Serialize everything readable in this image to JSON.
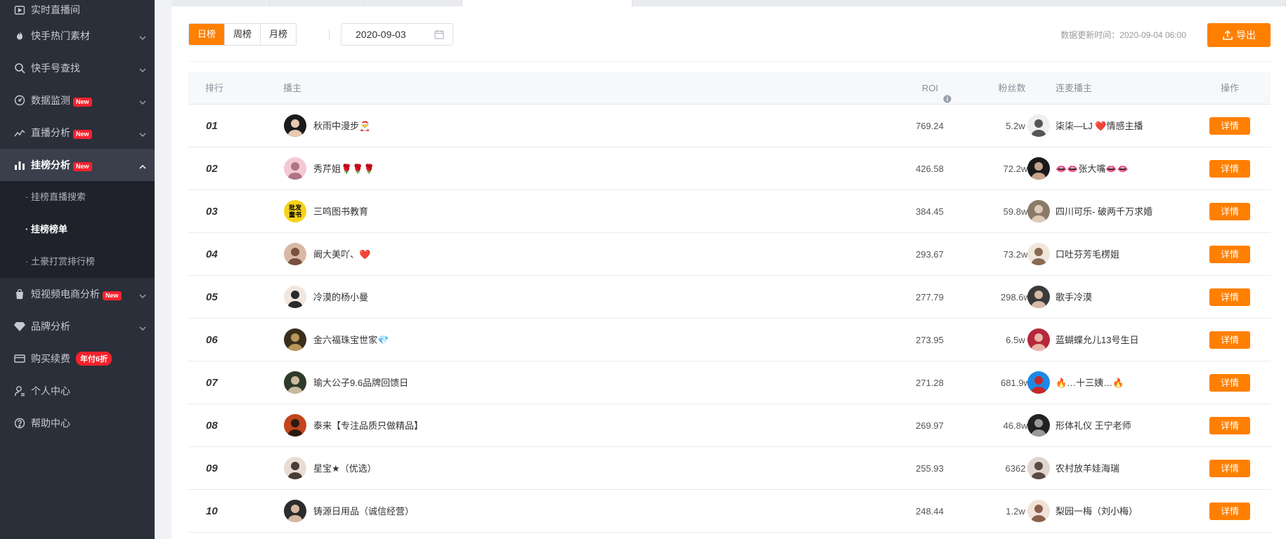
{
  "sidebar": {
    "items": [
      {
        "label": "实时直播间",
        "icon": "live-room-icon"
      },
      {
        "label": "快手热门素材",
        "icon": "fire-icon"
      },
      {
        "label": "快手号查找",
        "icon": "search-icon"
      },
      {
        "label": "数据监测",
        "icon": "monitor-icon",
        "badge": "New"
      },
      {
        "label": "直播分析",
        "icon": "trend-icon",
        "badge": "New"
      },
      {
        "label": "挂榜分析",
        "icon": "bar-chart-icon",
        "badge": "New"
      },
      {
        "label": "短视频电商分析",
        "icon": "bag-icon",
        "badge": "New"
      },
      {
        "label": "品牌分析",
        "icon": "diamond-icon"
      },
      {
        "label": "购买续费",
        "icon": "card-icon",
        "promo": "年付6折"
      },
      {
        "label": "个人中心",
        "icon": "user-icon"
      },
      {
        "label": "帮助中心",
        "icon": "help-icon"
      }
    ],
    "submenu": [
      "· 挂榜直播搜索",
      "· 挂榜榜单",
      "· 土豪打赏排行榜"
    ]
  },
  "toolbar": {
    "tabs": [
      "日榜",
      "周榜",
      "月榜"
    ],
    "active_tab": "日榜",
    "date": "2020-09-03",
    "update_time": "数据更新时间：2020-09-04 06:00",
    "export_label": "导出"
  },
  "table": {
    "headers": {
      "rank": "排行",
      "anchor": "播主",
      "roi": "ROI",
      "fans": "粉丝数",
      "mic": "连麦播主",
      "action": "操作"
    },
    "detail_label": "详情",
    "rows": [
      {
        "rank": "01",
        "name": "秋雨中漫步🎅",
        "roi": "769.24",
        "fans": "5.2w",
        "mic": "柒柒—LJ ❤️情感主播"
      },
      {
        "rank": "02",
        "name": "秀芹姐🌹🌹🌹",
        "roi": "426.58",
        "fans": "72.2w",
        "mic": "👄👄张大嘴👄👄"
      },
      {
        "rank": "03",
        "name": "三鸣图书教育",
        "roi": "384.45",
        "fans": "59.8w",
        "mic": "四川可乐- 破两千万求婚"
      },
      {
        "rank": "04",
        "name": "阚大美吖、❤️",
        "roi": "293.67",
        "fans": "73.2w",
        "mic": "口吐芬芳毛楞姐"
      },
      {
        "rank": "05",
        "name": "冷漠的杨小曼",
        "roi": "277.79",
        "fans": "298.6w",
        "mic": "歌手冷漠"
      },
      {
        "rank": "06",
        "name": "金六福珠宝世家💎",
        "roi": "273.95",
        "fans": "6.5w",
        "mic": "蓝蝴蝶允儿13号生日"
      },
      {
        "rank": "07",
        "name": "瑜大公子9.6品牌回馈日",
        "roi": "271.28",
        "fans": "681.9w",
        "mic": "🔥…十三姨…🔥"
      },
      {
        "rank": "08",
        "name": "泰来【专注品质只做精品】",
        "roi": "269.97",
        "fans": "46.8w",
        "mic": "形体礼仪 王宁老师"
      },
      {
        "rank": "09",
        "name": "星宝★（优选）",
        "roi": "255.93",
        "fans": "6362",
        "mic": "农村放羊娃海瑞"
      },
      {
        "rank": "10",
        "name": "铸源日用品（诚信经营）",
        "roi": "248.44",
        "fans": "1.2w",
        "mic": "梨园一梅（刘小梅）"
      }
    ],
    "avatar3_text": [
      "批发",
      "童书"
    ]
  },
  "colors": {
    "accent": "#ff7f00",
    "sidebar_bg": "#2b2f3a",
    "badge": "#f5222d"
  }
}
